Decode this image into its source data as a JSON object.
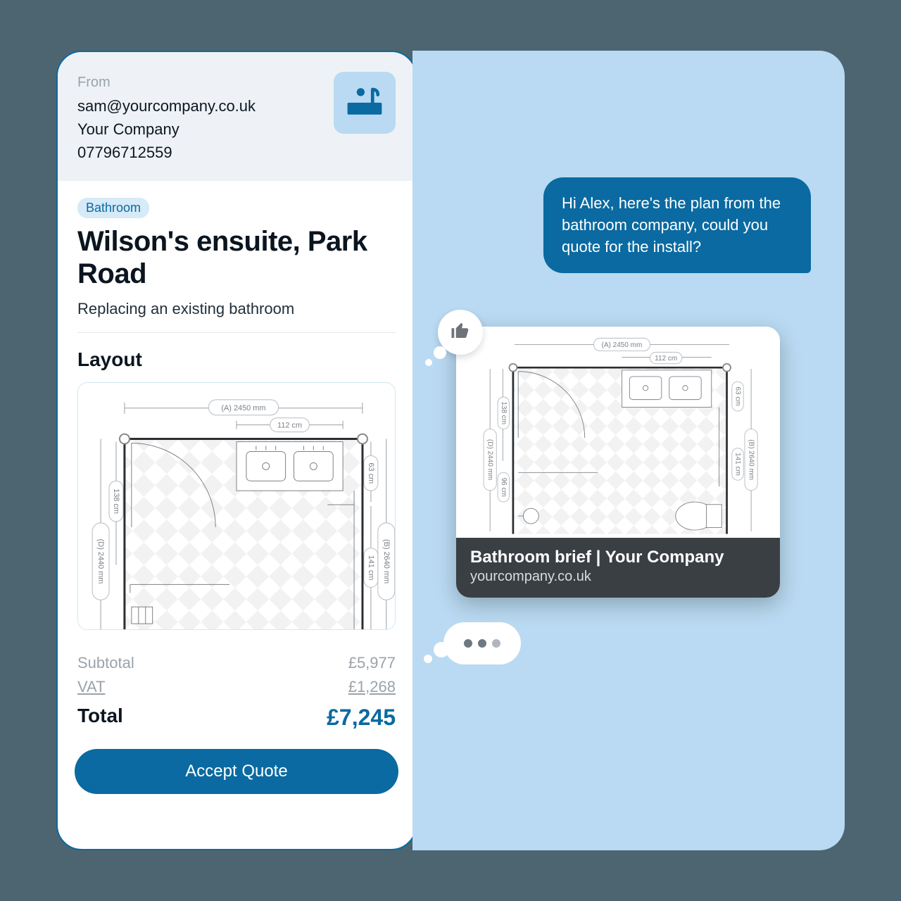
{
  "quote": {
    "from_label": "From",
    "email": "sam@yourcompany.co.uk",
    "company": "Your Company",
    "phone": "07796712559",
    "category_chip": "Bathroom",
    "title": "Wilson's ensuite, Park Road",
    "subtitle": "Replacing an existing bathroom",
    "section_layout": "Layout",
    "totals": {
      "subtotal_label": "Subtotal",
      "subtotal_value": "£5,977",
      "vat_label": "VAT",
      "vat_value": "£1,268",
      "total_label": "Total",
      "total_value": "£7,245"
    },
    "accept_label": "Accept Quote"
  },
  "floorplan": {
    "width_label": "(A) 2450 mm",
    "height_label_left": "(D) 2440 mm",
    "height_label_right": "(B) 2640 mm",
    "counter_width": "112 cm",
    "door_h": "138 cm",
    "sink_r_h": "63 cm",
    "wc_h": "141 cm"
  },
  "chat": {
    "message": "Hi Alex, here's the plan from the bathroom company, could you quote for the install?",
    "preview": {
      "title": "Bathroom brief | Your Company",
      "domain": "yourcompany.co.uk"
    },
    "thumb_dims": {
      "width_label": "(A) 2450 mm",
      "height_label_left": "(D) 2440 mm",
      "height_label_right": "(B) 2640 mm",
      "counter_width": "112 cm",
      "door_h": "138 cm",
      "sink_r_h": "63 cm",
      "wc_h": "141 cm",
      "extra": "96 cm"
    }
  },
  "colors": {
    "brand": "#0a6aa1",
    "chipbg": "#d6eaf7",
    "chatbg": "#b9daf2"
  }
}
